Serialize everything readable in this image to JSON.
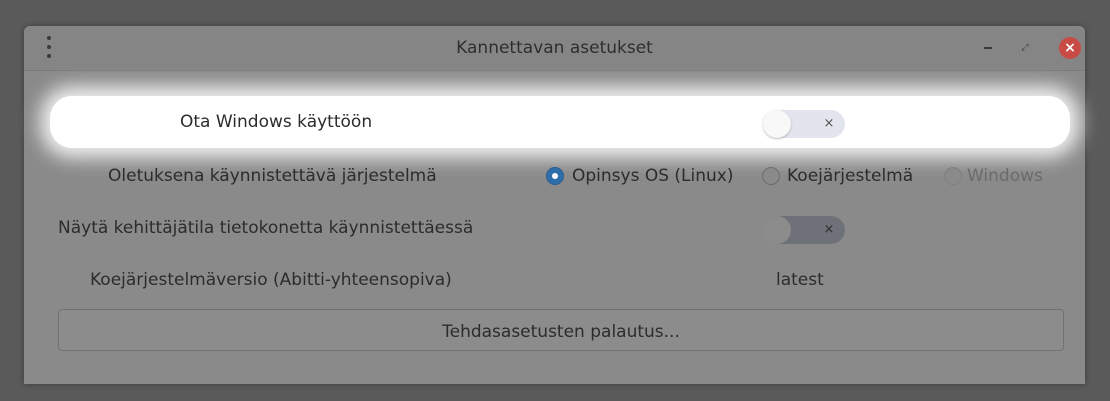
{
  "window": {
    "title": "Kannettavan asetukset"
  },
  "settings": {
    "enable_windows": {
      "label": "Ota Windows käyttöön",
      "toggle_symbol": "×",
      "enabled": false
    },
    "default_os": {
      "label": "Oletuksena käynnistettävä järjestelmä",
      "options": [
        {
          "label": "Opinsys OS (Linux)",
          "selected": true,
          "disabled": false
        },
        {
          "label": "Koejärjestelmä",
          "selected": false,
          "disabled": false
        },
        {
          "label": "Windows",
          "selected": false,
          "disabled": true
        }
      ]
    },
    "developer_mode": {
      "label": "Näytä kehittäjätila tietokonetta käynnistettäessä",
      "toggle_symbol": "×",
      "enabled": false
    },
    "exam_version": {
      "label": "Koejärjestelmäversio (Abitti-yhteensopiva)",
      "value": "latest"
    },
    "factory_reset": {
      "label": "Tehdasasetusten palautus..."
    }
  },
  "colors": {
    "accent": "#2f6ea8",
    "close_button": "#c84a45",
    "window_bg": "#8a8a8a"
  },
  "icons": {
    "menu": "vertical-dots-icon",
    "minimize": "minimize-icon",
    "maximize": "maximize-icon",
    "close": "close-icon"
  }
}
